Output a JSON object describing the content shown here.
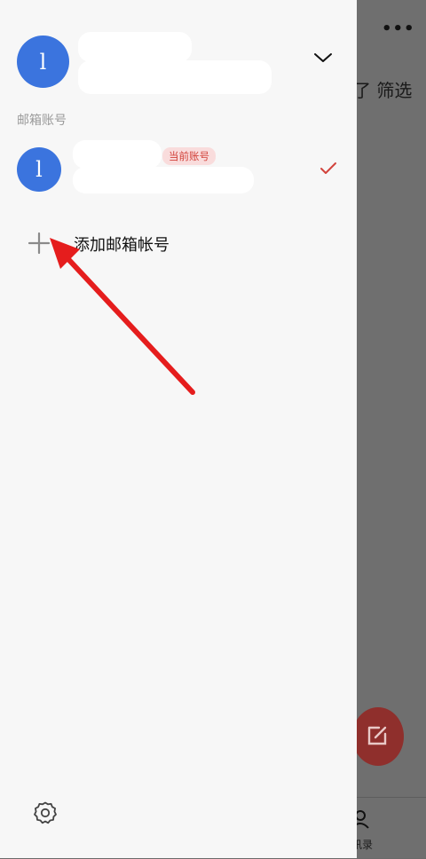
{
  "background_app": {
    "more_icon": "more-horizontal-icon",
    "filter_text": "了 筛选",
    "compose_icon": "compose-icon",
    "contacts_icon": "contacts-icon",
    "contacts_label": "讯录"
  },
  "drawer": {
    "primary_account": {
      "avatar_letter": "l",
      "expand_icon": "chevron-down-icon"
    },
    "section_title": "邮箱账号",
    "accounts": [
      {
        "avatar_letter": "l",
        "badge": "当前账号",
        "selected_icon": "checkmark-icon"
      }
    ],
    "add_account": {
      "icon": "plus-icon",
      "label": "添加邮箱帐号"
    },
    "settings_icon": "gear-icon"
  },
  "annotation": {
    "icon": "red-arrow-pointer",
    "color": "#e51d1d"
  }
}
